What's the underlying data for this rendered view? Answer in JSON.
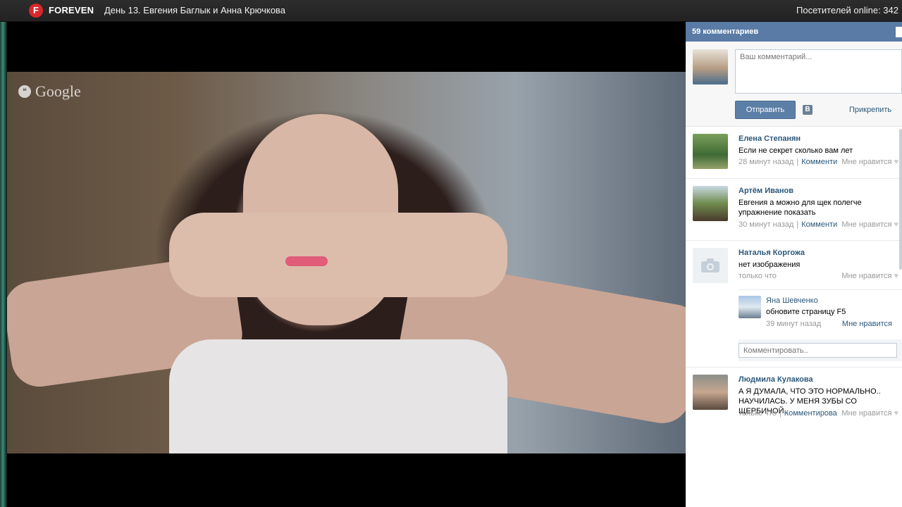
{
  "topbar": {
    "logo_letter": "F",
    "brand": "FOREVEN",
    "title": "День 13. Евгения Баглык и Анна Крючкова",
    "visitors": "Посетителей online: 342"
  },
  "video": {
    "watermark": "Google",
    "watermark_icon": "hangouts-icon"
  },
  "comments_panel": {
    "header": "59 комментариев",
    "compose": {
      "placeholder": "Ваш комментарий...",
      "send_label": "Отправить",
      "vk_icon_label": "В",
      "attach_label": "Прикрепить"
    },
    "comments": [
      {
        "name": "Елена Степанян",
        "text": "Если не секрет сколько вам лет",
        "time": "28 минут назад",
        "reply": "Комменти",
        "like": "Мне нравится"
      },
      {
        "name": "Артём Иванов",
        "text": "Евгения а можно для щек полегче упражнение показать",
        "time": "30 минут назад",
        "reply": "Комменти",
        "like": "Мне нравится"
      },
      {
        "name": "Наталья Коргожа",
        "text": "нет изображения",
        "time": "только что",
        "like": "Мне нравится",
        "replies": [
          {
            "name": "Яна Шевченко",
            "text": "обновите страницу F5",
            "time": "39 минут назад",
            "like": "Мне нравится"
          }
        ],
        "reply_placeholder": "Комментировать.."
      },
      {
        "name": "Людмила Кулакова",
        "text": "А Я ДУМАЛА, ЧТО ЭТО НОРМАЛЬНО.. НАУЧИЛАСЬ. У МЕНЯ ЗУБЫ СО ЩЕРБИНОЙ..",
        "time": "только что",
        "reply": "Комментирова",
        "like": "Мне нравится"
      }
    ]
  },
  "colors": {
    "header_blue": "#597ba5",
    "link_blue": "#2b587a",
    "logo_red": "#d8282b"
  }
}
